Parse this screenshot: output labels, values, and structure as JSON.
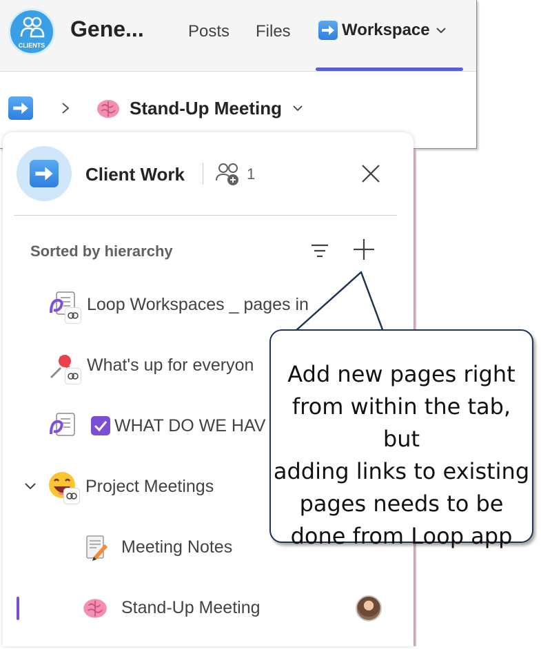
{
  "teams": {
    "avatar_label": "CLIENTS",
    "team_name": "Gene...",
    "tabs": {
      "posts": "Posts",
      "files": "Files",
      "workspace": "Workspace"
    },
    "breadcrumb": {
      "page_title": "Stand-Up Meeting"
    }
  },
  "panel": {
    "title": "Client Work",
    "member_count": "1",
    "sort_label": "Sorted by hierarchy",
    "items": [
      {
        "label": "Loop Workspaces _ pages in",
        "icon": "loop-page-icon",
        "linked": true
      },
      {
        "label": "What's up for everyon",
        "icon": "pushpin-icon",
        "linked": true
      },
      {
        "label": "WHAT DO WE HAV",
        "icon": "loop-page-icon",
        "linked": false
      },
      {
        "label": "Project Meetings",
        "icon": "grinning-face-icon",
        "linked": true,
        "expanded": true
      },
      {
        "label": "Meeting Notes",
        "icon": "memo-icon",
        "linked": false
      },
      {
        "label": "Stand-Up Meeting",
        "icon": "brain-icon",
        "linked": false,
        "active": true
      }
    ]
  },
  "callout": {
    "lines": [
      "Add new pages right",
      "from within the tab, but",
      "adding links to existing",
      "pages needs to be",
      "done from Loop app"
    ]
  },
  "colors": {
    "accent": "#5b5fc7",
    "active_indicator": "#7a4fd6",
    "callout_border": "#1f3350"
  }
}
